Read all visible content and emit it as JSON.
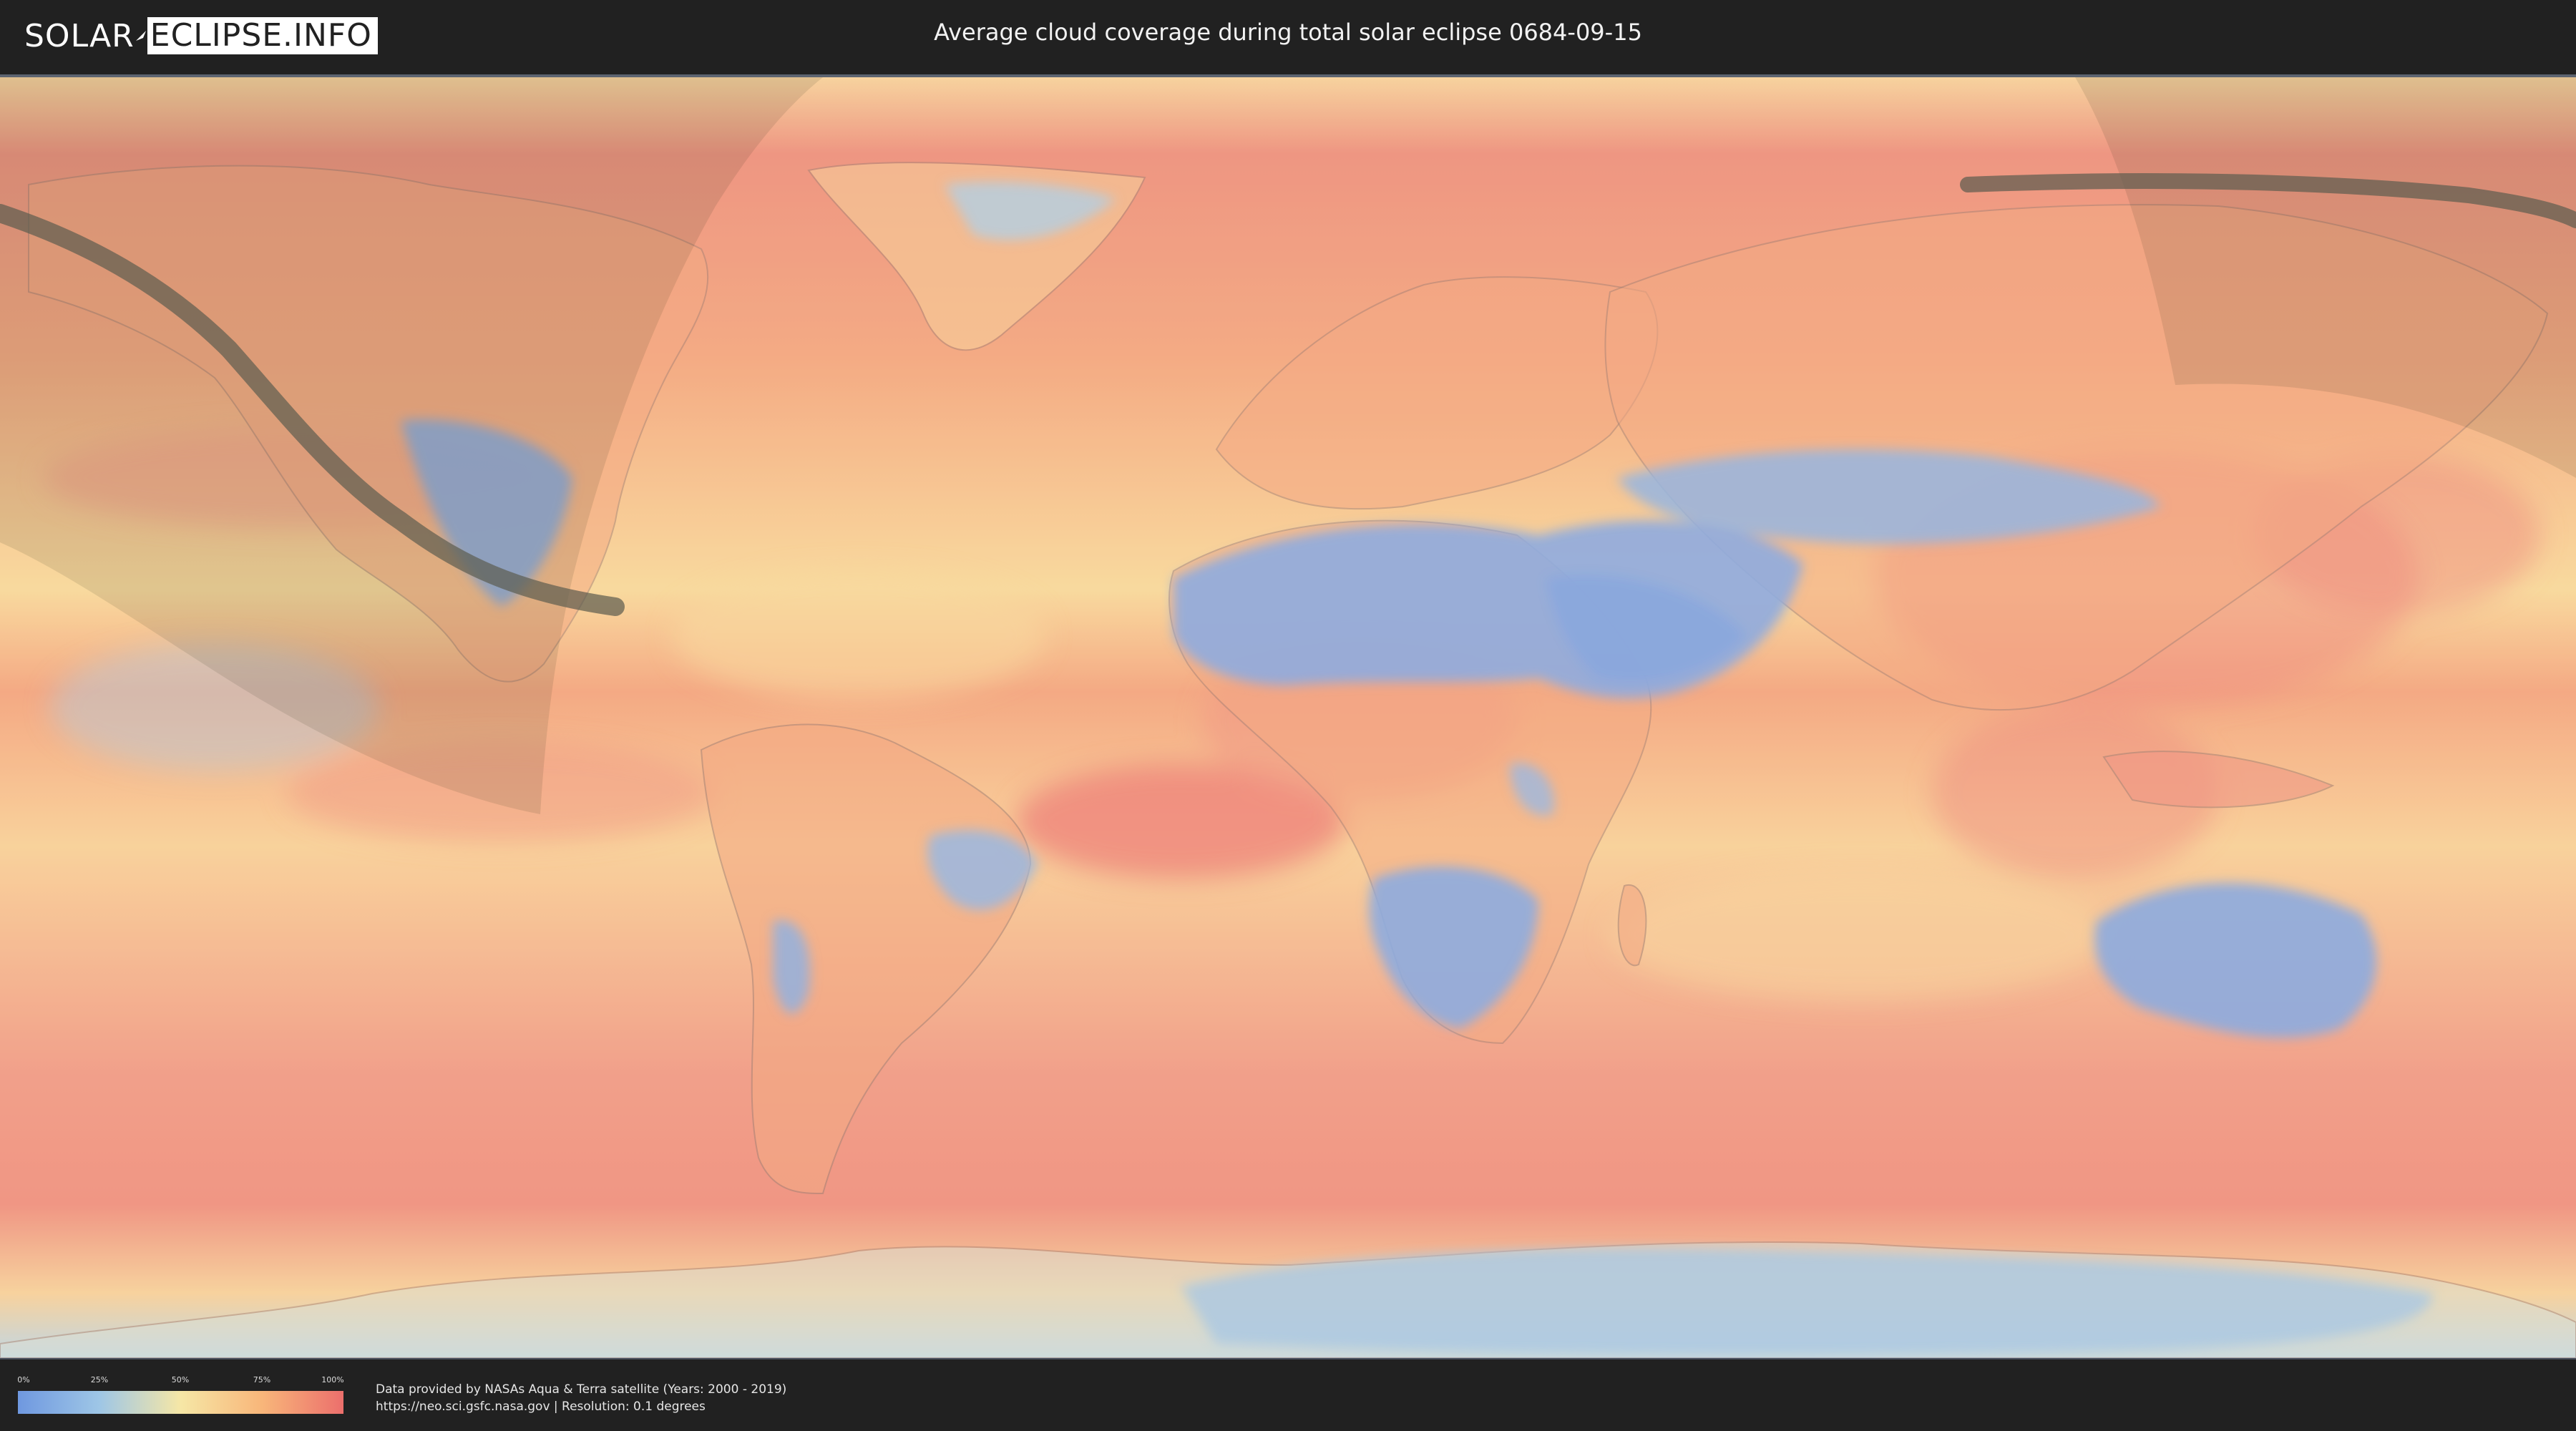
{
  "header": {
    "logo_left": "SOLAR",
    "logo_right": "ECLIPSE.INFO",
    "title": "Average cloud coverage during total solar eclipse 0684-09-15"
  },
  "map": {
    "type": "world-cloud-coverage",
    "projection": "equirectangular",
    "eclipse_path_color": "#5b5b4e",
    "visibility_overlay_color": "#ecdcae",
    "colors": {
      "clear": "#6f98e0",
      "low": "#9ec6e6",
      "medium": "#f6e7a6",
      "high": "#f8b67a",
      "overcast": "#ec6f6c"
    }
  },
  "legend": {
    "ticks": [
      "0%",
      "25%",
      "50%",
      "75%",
      "100%"
    ],
    "gradient_colors": [
      "#6f98e0",
      "#9ec6e6",
      "#f6e7a6",
      "#f8b67a",
      "#ec6f6c"
    ]
  },
  "credits": {
    "line1": "Data provided by NASAs Aqua & Terra satellite (Years: 2000 - 2019)",
    "line2": "https://neo.sci.gsfc.nasa.gov | Resolution: 0.1 degrees"
  }
}
